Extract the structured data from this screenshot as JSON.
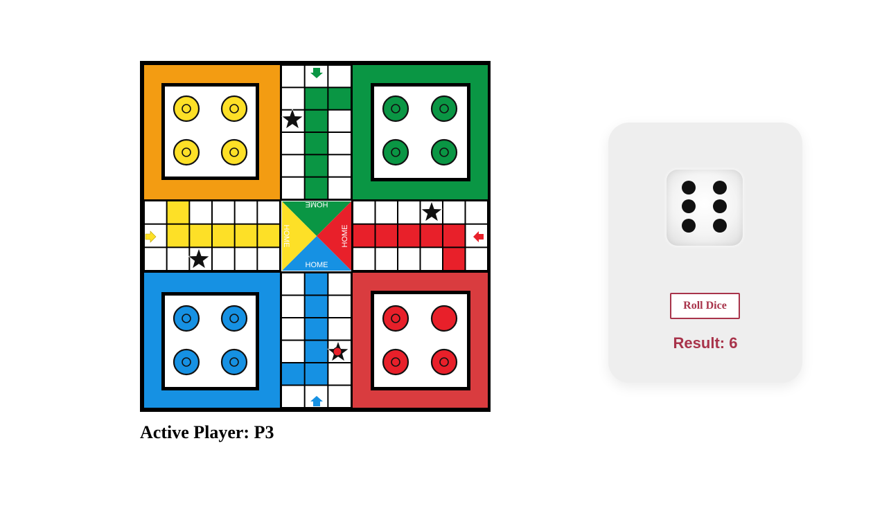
{
  "board": {
    "home_label": "HOME",
    "colors": {
      "yellow_base": "#f39c12",
      "yellow": "#fde027",
      "green": "#0a9644",
      "blue": "#1691e3",
      "red_base": "#d93c3f",
      "red": "#e8202a"
    },
    "icons": {
      "star": "star-icon",
      "arrow": "arrow-icon"
    },
    "tokens": [
      {
        "name": "yellow-token-1",
        "color": "yellow",
        "variant": "ring"
      },
      {
        "name": "yellow-token-2",
        "color": "yellow",
        "variant": "ring"
      },
      {
        "name": "yellow-token-3",
        "color": "yellow",
        "variant": "ring"
      },
      {
        "name": "yellow-token-4",
        "color": "yellow",
        "variant": "ring"
      },
      {
        "name": "green-token-1",
        "color": "green",
        "variant": "ring"
      },
      {
        "name": "green-token-2",
        "color": "green",
        "variant": "ring"
      },
      {
        "name": "green-token-3",
        "color": "green",
        "variant": "ring"
      },
      {
        "name": "green-token-4",
        "color": "green",
        "variant": "ring"
      },
      {
        "name": "blue-token-1",
        "color": "blue",
        "variant": "ring"
      },
      {
        "name": "blue-token-2",
        "color": "blue",
        "variant": "ring"
      },
      {
        "name": "blue-token-3",
        "color": "blue",
        "variant": "ring"
      },
      {
        "name": "blue-token-4",
        "color": "blue",
        "variant": "ring"
      },
      {
        "name": "red-token-1",
        "color": "red",
        "variant": "ring"
      },
      {
        "name": "red-token-2",
        "color": "red",
        "variant": "solid"
      },
      {
        "name": "red-token-3",
        "color": "red",
        "variant": "ring"
      },
      {
        "name": "red-token-4",
        "color": "red",
        "variant": "ring"
      },
      {
        "name": "red-token-on-track",
        "color": "red",
        "variant": "small"
      }
    ]
  },
  "status": {
    "active_player_label": "Active Player: P3"
  },
  "dice": {
    "value": 6,
    "roll_button_label": "Roll Dice",
    "result_label": "Result: 6",
    "accent_color": "#a8334a"
  }
}
